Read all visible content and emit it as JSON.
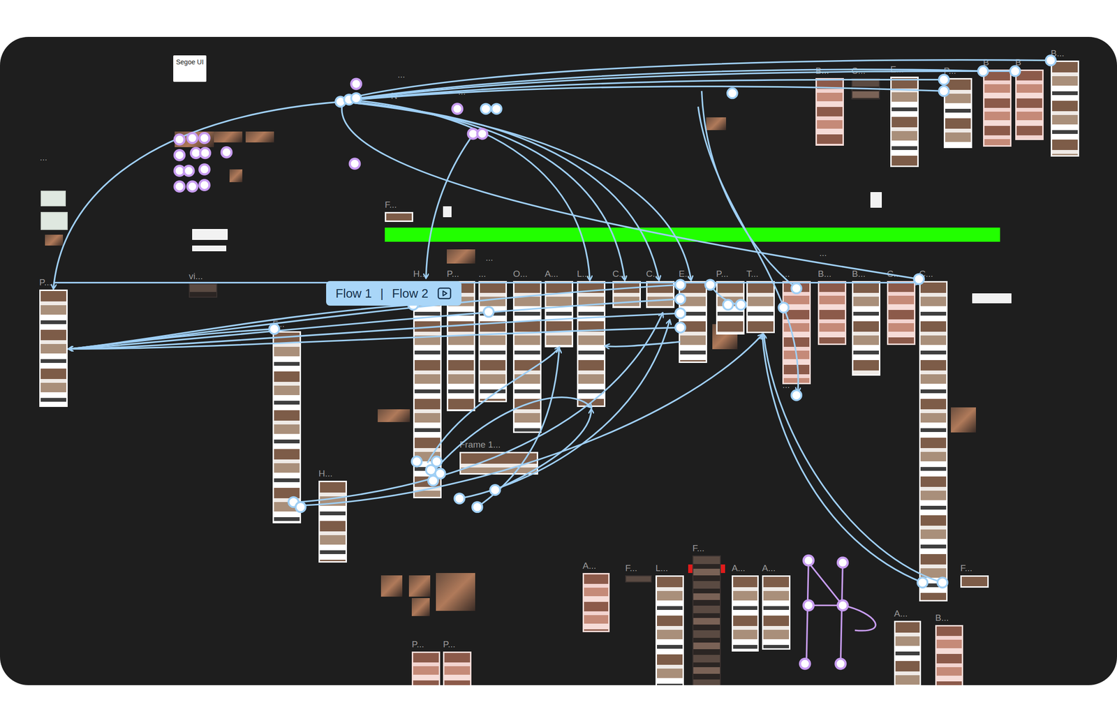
{
  "canvas": {
    "flows": {
      "items": [
        {
          "label": "Flow 1",
          "selected": false
        },
        {
          "label": "Flow 2",
          "selected": false
        }
      ],
      "separator": "|"
    },
    "frames": [
      {
        "label": "P...",
        "kind": "light"
      },
      {
        "label": "vi...",
        "kind": "dark"
      },
      {
        "label": "F...",
        "kind": "light"
      },
      {
        "label": "H...",
        "kind": "light"
      },
      {
        "label": "H...",
        "kind": "light"
      },
      {
        "label": "P...",
        "kind": "light"
      },
      {
        "label": "...",
        "kind": "light"
      },
      {
        "label": "O...",
        "kind": "light"
      },
      {
        "label": "A...",
        "kind": "light"
      },
      {
        "label": "L...",
        "kind": "light"
      },
      {
        "label": "C...",
        "kind": "light"
      },
      {
        "label": "C...",
        "kind": "light"
      },
      {
        "label": "E...",
        "kind": "light"
      },
      {
        "label": "P...",
        "kind": "light"
      },
      {
        "label": "T...",
        "kind": "light"
      },
      {
        "label": "...",
        "kind": "pink"
      },
      {
        "label": "B...",
        "kind": "pink"
      },
      {
        "label": "B...",
        "kind": "light"
      },
      {
        "label": "C...",
        "kind": "pink"
      },
      {
        "label": "C...",
        "kind": "light"
      },
      {
        "label": "B...",
        "kind": "pink"
      },
      {
        "label": "C...",
        "kind": "dark"
      },
      {
        "label": "E...",
        "kind": "light"
      },
      {
        "label": "P...",
        "kind": "light"
      },
      {
        "label": "B",
        "kind": "pink"
      },
      {
        "label": "B",
        "kind": "pink"
      },
      {
        "label": "B...",
        "kind": "light"
      },
      {
        "label": "A...",
        "kind": "pink"
      },
      {
        "label": "F...",
        "kind": "dark"
      },
      {
        "label": "L...",
        "kind": "light"
      },
      {
        "label": "F...",
        "kind": "dark"
      },
      {
        "label": "A...",
        "kind": "light"
      },
      {
        "label": "A...",
        "kind": "light"
      },
      {
        "label": "A...",
        "kind": "light"
      },
      {
        "label": "B...",
        "kind": "pink"
      },
      {
        "label": "F...",
        "kind": "light"
      },
      {
        "label": "P...",
        "kind": "pink"
      },
      {
        "label": "P...",
        "kind": "pink"
      },
      {
        "label": "F...",
        "kind": "light"
      },
      {
        "label": "Frame 1...",
        "kind": "light"
      }
    ],
    "notes": [
      {
        "text": "Segoe UI",
        "kind": "card"
      },
      {
        "text": "...",
        "kind": "label"
      },
      {
        "text": "...",
        "kind": "label"
      },
      {
        "text": "...",
        "kind": "label"
      },
      {
        "text": "...",
        "kind": "label"
      },
      {
        "text": "...",
        "kind": "label"
      },
      {
        "text": "...",
        "kind": "label"
      },
      {
        "text": "N",
        "kind": "label"
      }
    ]
  }
}
